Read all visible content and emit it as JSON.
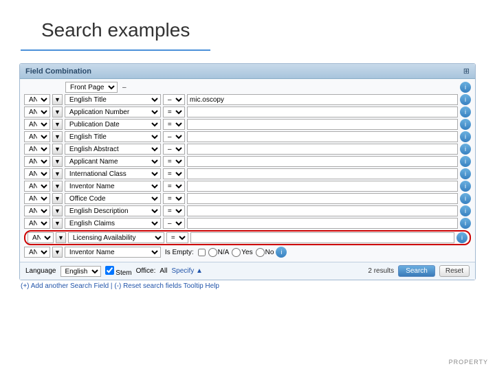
{
  "title": "Search examples",
  "panel": {
    "header": "Field Combination",
    "rows": [
      {
        "op": "",
        "field": "English Title",
        "cond": "–",
        "value": "mic.oscopy",
        "show_op_btn": true
      },
      {
        "op": "AND",
        "field": "Application Number",
        "cond": "=",
        "value": "",
        "show_op_btn": true
      },
      {
        "op": "AND",
        "field": "Publication Date",
        "cond": "=",
        "value": "",
        "show_op_btn": true
      },
      {
        "op": "AND",
        "field": "English Title",
        "cond": "–",
        "value": "",
        "show_op_btn": true
      },
      {
        "op": "AND",
        "field": "English Abstract",
        "cond": "–",
        "value": "",
        "show_op_btn": true
      },
      {
        "op": "AND",
        "field": "Applicant Name",
        "cond": "=",
        "value": "",
        "show_op_btn": true
      },
      {
        "op": "AND",
        "field": "International Class",
        "cond": "=",
        "value": "",
        "show_op_btn": true
      },
      {
        "op": "AND",
        "field": "Inventor Name",
        "cond": "=",
        "value": "",
        "show_op_btn": true
      },
      {
        "op": "AND",
        "field": "Office Code",
        "cond": "=",
        "value": "",
        "show_op_btn": true
      },
      {
        "op": "AND",
        "field": "English Description",
        "cond": "=",
        "value": "",
        "show_op_btn": true
      },
      {
        "op": "AND",
        "field": "English Claims",
        "cond": "–",
        "value": "",
        "show_op_btn": true
      },
      {
        "op": "AND",
        "field": "Licensing Availability",
        "cond": "=",
        "value": "",
        "highlighted": true,
        "show_op_btn": true
      },
      {
        "op": "AND",
        "field": "Inventor Name",
        "cond": "Is Empty:",
        "radio": true,
        "show_op_btn": true
      }
    ],
    "footer": {
      "language_label": "Language",
      "language_value": "English",
      "stem_label": "Stem",
      "office_label": "Office:",
      "office_value": "All",
      "specify_label": "Specify ▲",
      "results_count": "2 results",
      "search_btn": "Search",
      "reset_btn": "Reset"
    },
    "bottom": {
      "add_link": "(+) Add another Search Field",
      "separator": "|",
      "reset_link": "(-) Reset search fields",
      "tooltip_label": "Tooltip",
      "help_label": "Help"
    }
  }
}
